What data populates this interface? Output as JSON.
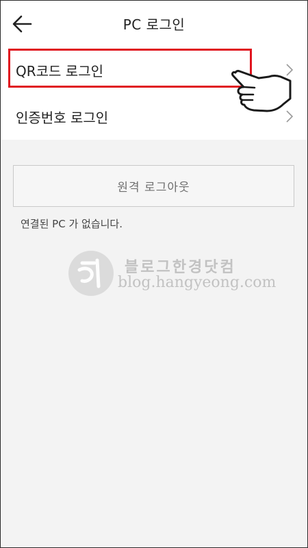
{
  "header": {
    "title": "PC 로그인",
    "back_icon": "back-arrow-icon"
  },
  "menu": {
    "items": [
      {
        "label": "QR코드 로그인",
        "icon": "chevron-right-icon"
      },
      {
        "label": "인증번호 로그인",
        "icon": "chevron-right-icon"
      }
    ]
  },
  "remote_logout": {
    "label": "원격 로그아웃"
  },
  "status": {
    "text": "연결된 PC 가 없습니다."
  },
  "watermark": {
    "line1": "블로그한경닷컴",
    "line2": "blog.hangyeong.com"
  },
  "colors": {
    "highlight": "#e0141e",
    "background": "#f3f3f3",
    "surface": "#ffffff"
  }
}
